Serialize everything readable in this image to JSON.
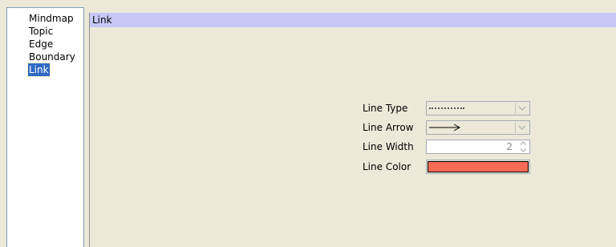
{
  "nav": {
    "items": [
      {
        "label": "Mindmap",
        "selected": false
      },
      {
        "label": "Topic",
        "selected": false
      },
      {
        "label": "Edge",
        "selected": false
      },
      {
        "label": "Boundary",
        "selected": false
      },
      {
        "label": "Link",
        "selected": true
      }
    ]
  },
  "panel": {
    "title": "Link"
  },
  "form": {
    "line_type": {
      "label": "Line Type",
      "value_icon": "dotted-line-icon"
    },
    "line_arrow": {
      "label": "Line Arrow",
      "value_icon": "right-arrow-icon"
    },
    "line_width": {
      "label": "Line Width",
      "value": "2"
    },
    "line_color": {
      "label": "Line Color",
      "value": "#f56b55"
    }
  },
  "colors": {
    "header_bg": "#c8c8f8",
    "window_bg": "#ece9d8",
    "selection_bg": "#316ac5"
  }
}
